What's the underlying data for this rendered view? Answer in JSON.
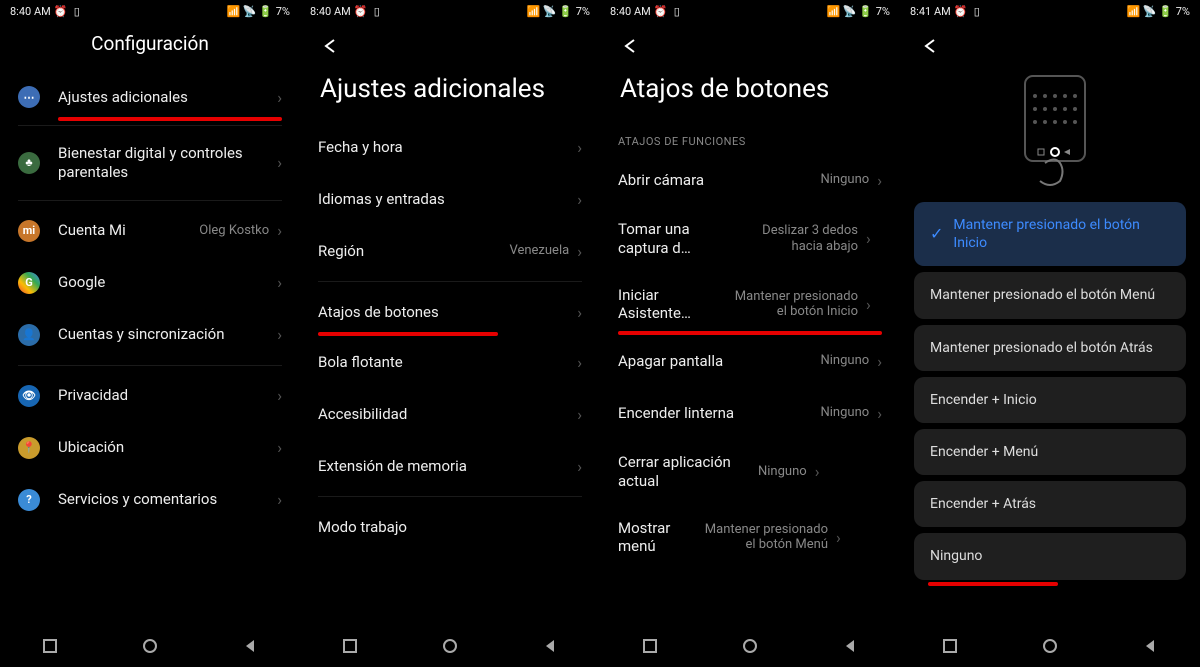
{
  "statusbar": {
    "time1": "8:40 AM",
    "time2": "8:41 AM",
    "battery": "7%"
  },
  "screen1": {
    "title": "Configuración",
    "items": [
      {
        "label": "Ajustes adicionales"
      },
      {
        "label": "Bienestar digital y controles parentales"
      },
      {
        "label": "Cuenta Mi",
        "value": "Oleg Kostko"
      },
      {
        "label": "Google"
      },
      {
        "label": "Cuentas y sincronización"
      },
      {
        "label": "Privacidad"
      },
      {
        "label": "Ubicación"
      },
      {
        "label": "Servicios y comentarios"
      }
    ]
  },
  "screen2": {
    "title": "Ajustes adicionales",
    "items": [
      {
        "label": "Fecha y hora"
      },
      {
        "label": "Idiomas y entradas"
      },
      {
        "label": "Región",
        "value": "Venezuela"
      },
      {
        "label": "Atajos de botones"
      },
      {
        "label": "Bola flotante"
      },
      {
        "label": "Accesibilidad"
      },
      {
        "label": "Extensión de memoria"
      },
      {
        "label": "Modo trabajo"
      }
    ]
  },
  "screen3": {
    "title": "Atajos de botones",
    "section": "ATAJOS DE FUNCIONES",
    "items": [
      {
        "label": "Abrir cámara",
        "value": "Ninguno"
      },
      {
        "label": "Tomar una captura d…",
        "value": "Deslizar 3 dedos hacia abajo"
      },
      {
        "label": "Iniciar Asistente…",
        "value": "Mantener presionado el botón Inicio"
      },
      {
        "label": "Apagar pantalla",
        "value": "Ninguno"
      },
      {
        "label": "Encender linterna",
        "value": "Ninguno"
      },
      {
        "label": "Cerrar aplicación actual",
        "value": "Ninguno"
      },
      {
        "label": "Mostrar menú",
        "value": "Mantener presionado el botón Menú"
      }
    ]
  },
  "screen4": {
    "options": [
      "Mantener presionado el botón Inicio",
      "Mantener presionado el botón Menú",
      "Mantener presionado el botón Atrás",
      "Encender + Inicio",
      "Encender + Menú",
      "Encender + Atrás",
      "Ninguno"
    ]
  }
}
